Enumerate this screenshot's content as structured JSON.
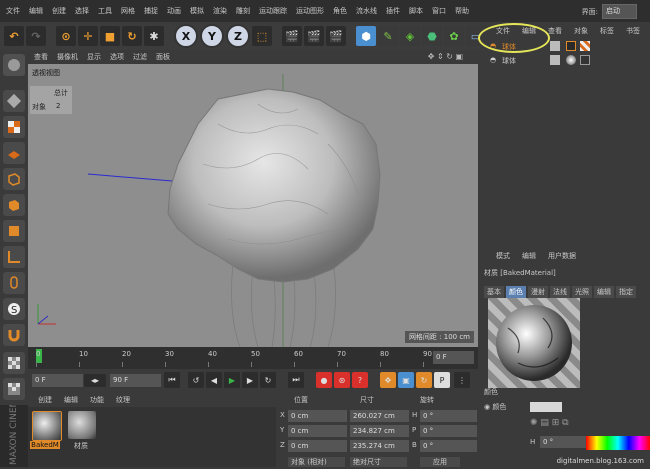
{
  "menu": {
    "items": [
      "文件",
      "编辑",
      "创建",
      "选择",
      "工具",
      "网格",
      "捕捉",
      "动画",
      "模拟",
      "渲染",
      "雕刻",
      "运动跟踪",
      "运动图形",
      "角色",
      "流水线",
      "插件",
      "脚本",
      "窗口",
      "帮助"
    ],
    "layout_label": "界面:",
    "layout_value": "启动"
  },
  "toolbar": {
    "axis_x": "X",
    "axis_y": "Y",
    "axis_z": "Z"
  },
  "viewport": {
    "menu": [
      "查看",
      "摄像机",
      "显示",
      "选项",
      "过滤",
      "面板"
    ],
    "title": "透视视图",
    "stats_header": "总计",
    "stats_label": "对象",
    "stats_value": "2",
    "grid_label": "网格间距 : 100 cm"
  },
  "timeline": {
    "ticks": [
      "0",
      "10",
      "20",
      "30",
      "40",
      "50",
      "60",
      "70",
      "80",
      "90"
    ],
    "current_frame": "0 F"
  },
  "playback": {
    "start_frame": "0 F",
    "end_frame": "90 F"
  },
  "material_manager": {
    "menu": [
      "创建",
      "编辑",
      "功能",
      "纹理"
    ],
    "materials": [
      {
        "label": "BakedM"
      },
      {
        "label": "材质"
      }
    ]
  },
  "coordinates": {
    "headers": {
      "position": "位置",
      "size": "尺寸",
      "rotation": "旋转"
    },
    "rows": [
      {
        "axis": "X",
        "pos": "0 cm",
        "size": "260.027 cm",
        "rot_axis": "H",
        "rot": "0 °"
      },
      {
        "axis": "Y",
        "pos": "0 cm",
        "size": "234.827 cm",
        "rot_axis": "P",
        "rot": "0 °"
      },
      {
        "axis": "Z",
        "pos": "0 cm",
        "size": "235.274 cm",
        "rot_axis": "B",
        "rot": "0 °"
      }
    ],
    "mode_object": "对象 (相对)",
    "mode_size": "绝对尺寸",
    "apply": "应用"
  },
  "object_manager": {
    "tabs": [
      "文件",
      "编辑",
      "查看",
      "对象",
      "标签",
      "书签"
    ],
    "objects": [
      {
        "name": "球体"
      },
      {
        "name": "球体"
      }
    ]
  },
  "attributes": {
    "tabs": [
      "模式",
      "编辑",
      "用户数据"
    ],
    "material_title": "材质 [BakedMaterial]",
    "sub_tabs": [
      "基本",
      "颜色",
      "漫射",
      "法线",
      "光照",
      "编辑",
      "指定"
    ],
    "active_sub_tab": "颜色",
    "color_header": "颜色",
    "color_label": "颜色",
    "h_label": "H",
    "h_value": "0 °"
  },
  "watermark": "digitalmen.blog.163.com",
  "brand": "MAXON CINEMA 4D",
  "colors": {
    "accent_selected": "#5a7fb0",
    "highlight_ring": "#e5e55a",
    "play_green": "#39b54a",
    "record_red": "#d9302c"
  }
}
